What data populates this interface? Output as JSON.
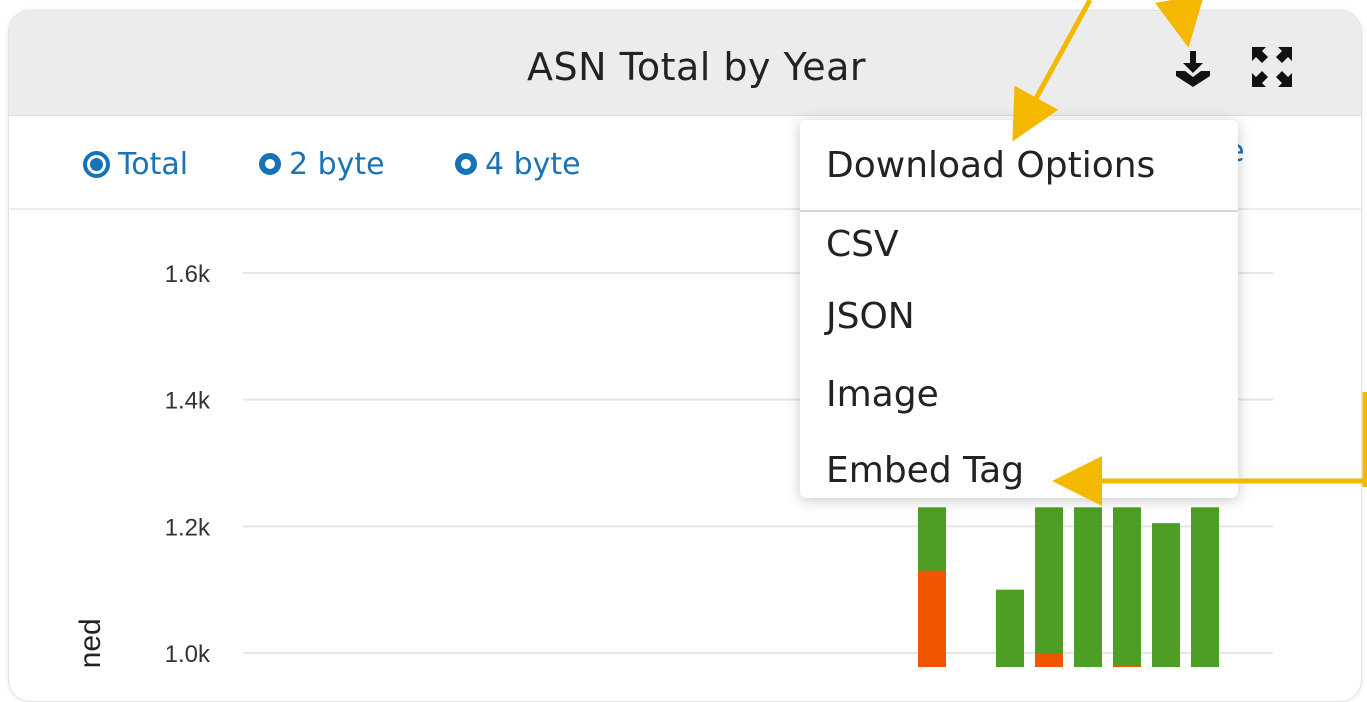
{
  "widget": {
    "title": "ASN Total by Year",
    "download_icon": "download-tray-icon",
    "fullscreen_icon": "expand-arrows-icon"
  },
  "radios": [
    {
      "label": "Total",
      "selected": true
    },
    {
      "label": "2 byte",
      "selected": false
    },
    {
      "label": "4 byte",
      "selected": false
    }
  ],
  "partially_hidden_text": "ive",
  "dropdown": {
    "header": "Download Options",
    "items": [
      "CSV",
      "JSON",
      "Image",
      "Embed Tag"
    ]
  },
  "chart_data": {
    "type": "bar",
    "ylabel": "gned",
    "yticks": [
      "1.6k",
      "1.4k",
      "1.2k",
      "1.0k"
    ],
    "ytick_values": [
      1600,
      1400,
      1200,
      1000
    ],
    "series": [
      {
        "color": "#f05500",
        "values": [
          1130,
          0,
          1000,
          0,
          980,
          0,
          0
        ]
      },
      {
        "color": "#4e9e26",
        "values": [
          1230,
          1100,
          1230,
          1230,
          1230,
          1205,
          1230
        ]
      }
    ],
    "note": "visible bars are partially hidden by dropdown"
  },
  "colors": {
    "accent": "#1673b8",
    "annotation": "#f5b800",
    "green": "#4e9e26",
    "orange": "#f05500"
  }
}
